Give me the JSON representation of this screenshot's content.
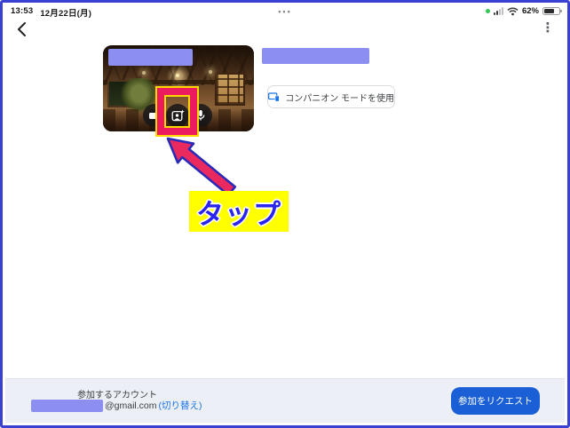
{
  "status_bar": {
    "time": "13:53",
    "date": "12月22日(月)",
    "multitask_dots": "•••",
    "battery_percent": "62%",
    "battery_level": "62%"
  },
  "app_bar": {
    "menu_icon": "⋮"
  },
  "meeting": {
    "companion_button_label": "コンパニオン モードを使用",
    "preview_buttons": [
      "videocam",
      "effects",
      "microphone"
    ]
  },
  "annotation": {
    "tap_label": "タップ"
  },
  "footer": {
    "account_heading": "参加するアカウント",
    "email_domain": "@gmail.com",
    "switch_label": "(切り替え)",
    "join_button_label": "参加をリクエスト"
  },
  "colors": {
    "frame_blue": "#3a41d2",
    "redaction_purple": "#8d8ff0",
    "highlight_red": "#ec1a5e",
    "highlight_yellow": "#ffd800",
    "tap_box_yellow": "#ffff00",
    "tap_text_blue": "#2a24ee",
    "link_blue": "#1a73e8",
    "join_button_blue": "#1a5fd6",
    "hotspot_green": "#34c759"
  }
}
